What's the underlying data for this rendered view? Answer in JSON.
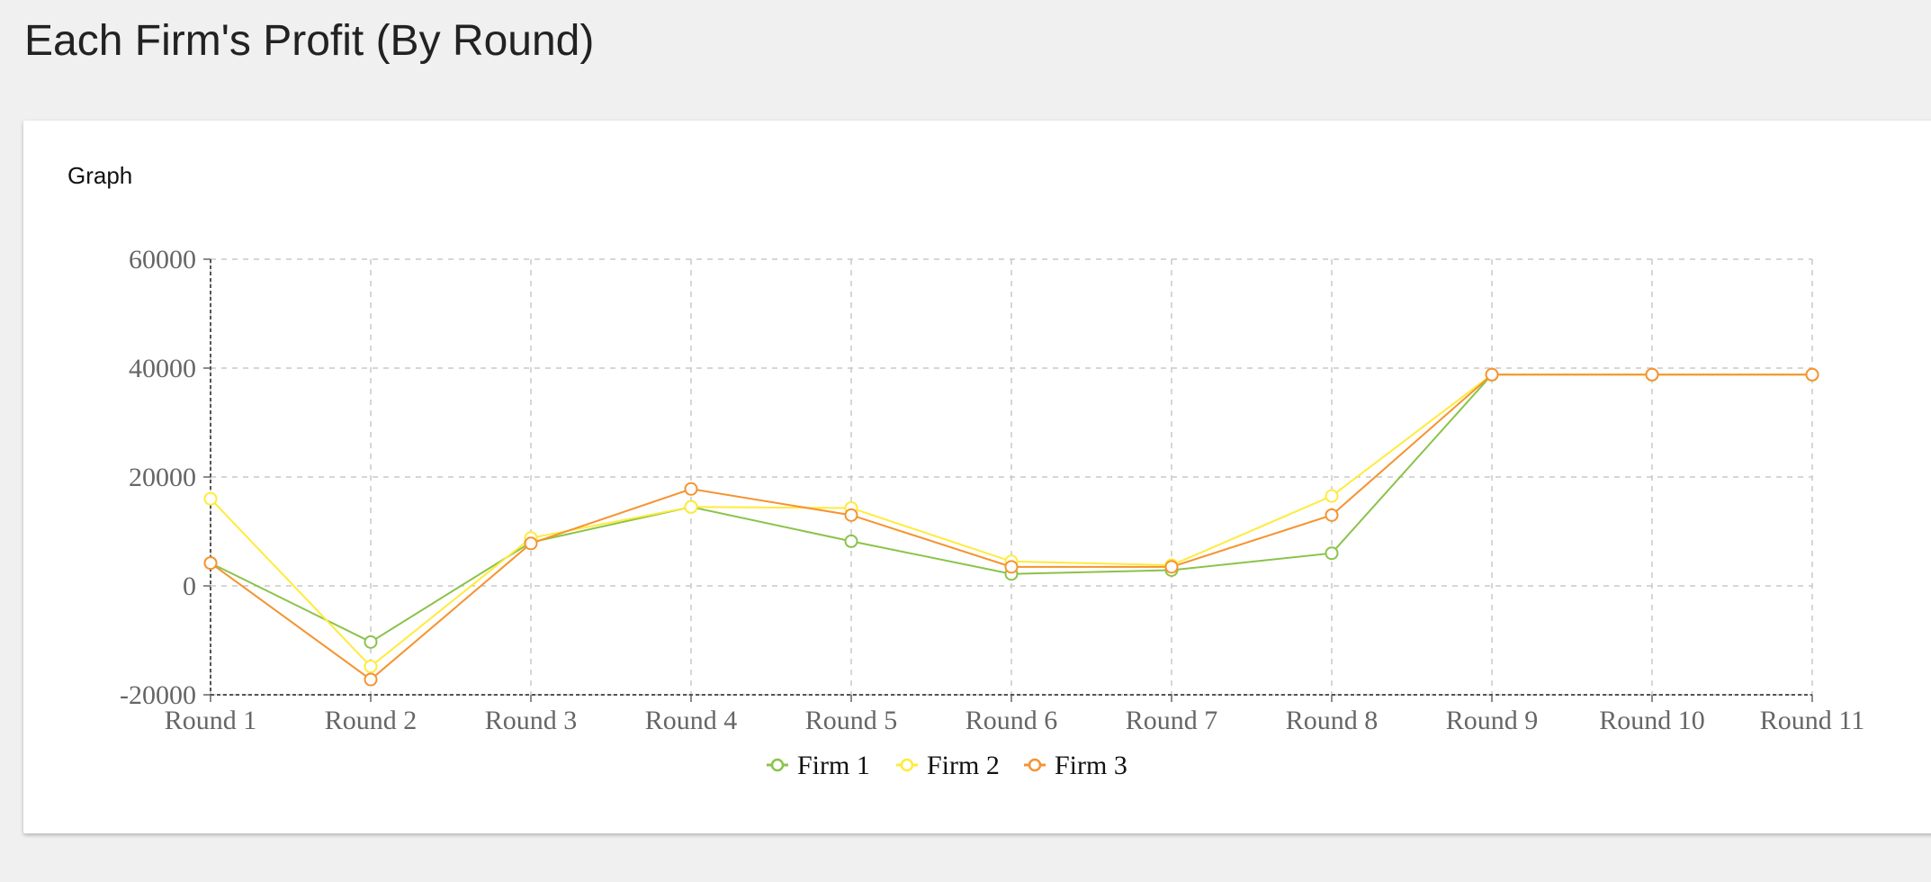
{
  "page": {
    "title": "Each Firm's Profit (By Round)"
  },
  "card": {
    "title": "Graph"
  },
  "chart_data": {
    "type": "line",
    "categories": [
      "Round 1",
      "Round 2",
      "Round 3",
      "Round 4",
      "Round 5",
      "Round 6",
      "Round 7",
      "Round 8",
      "Round 9",
      "Round 10",
      "Round 11"
    ],
    "ylim": [
      -20000,
      60000
    ],
    "yticks": [
      60000,
      40000,
      20000,
      0,
      -20000
    ],
    "grid": true,
    "legend_position": "bottom-center",
    "series": [
      {
        "name": "Firm 1",
        "color": "#8bc34a",
        "values": [
          4200,
          -10300,
          8000,
          14500,
          8200,
          2200,
          2900,
          6000,
          38800,
          38800,
          38800
        ]
      },
      {
        "name": "Firm 2",
        "color": "#ffeb3b",
        "values": [
          16000,
          -14800,
          8800,
          14500,
          14300,
          4500,
          3800,
          16500,
          38800,
          38800,
          38800
        ]
      },
      {
        "name": "Firm 3",
        "color": "#f59331",
        "values": [
          4200,
          -17200,
          7800,
          17800,
          13000,
          3500,
          3500,
          13000,
          38800,
          38800,
          38800
        ]
      }
    ]
  }
}
